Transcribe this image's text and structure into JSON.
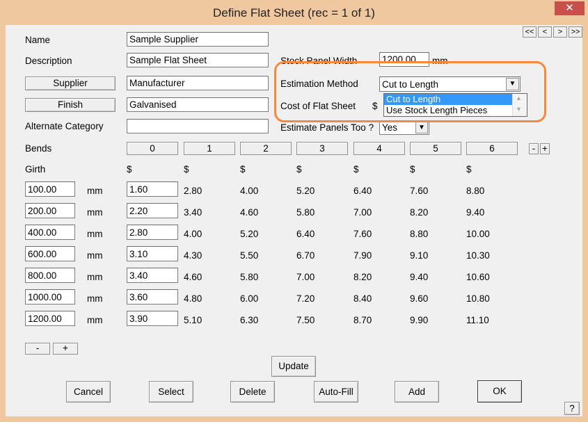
{
  "window": {
    "title": "Define Flat Sheet (rec = 1 of 1)",
    "close_glyph": "✕"
  },
  "nav": {
    "first": "<<",
    "prev": "<",
    "next": ">",
    "last": ">>"
  },
  "fields": {
    "name_label": "Name",
    "name_value": "Sample Supplier",
    "description_label": "Description",
    "description_value": "Sample Flat Sheet",
    "supplier_button": "Supplier",
    "supplier_value": "Manufacturer",
    "finish_button": "Finish",
    "finish_value": "Galvanised",
    "alt_category_label": "Alternate Category",
    "alt_category_value": ""
  },
  "right": {
    "stock_panel_label": "Stock Panel Width",
    "stock_panel_value": "1200.00",
    "stock_panel_unit": "mm",
    "estimation_label": "Estimation Method",
    "estimation_value": "Cut to Length",
    "estimation_options": [
      "Cut to Length",
      "Use Stock Length Pieces"
    ],
    "cost_label": "Cost of Flat Sheet",
    "cost_prefix": "$",
    "estimate_panels_label": "Estimate Panels Too ?",
    "estimate_panels_value": "Yes"
  },
  "bends": {
    "label": "Bends",
    "values": [
      "0",
      "1",
      "2",
      "3",
      "4",
      "5",
      "6"
    ],
    "minus": "-",
    "plus": "+"
  },
  "girth": {
    "label": "Girth",
    "currency": "$",
    "unit": "mm",
    "rows": [
      {
        "girth": "100.00",
        "prices": [
          "1.60",
          "2.80",
          "4.00",
          "5.20",
          "6.40",
          "7.60",
          "8.80"
        ]
      },
      {
        "girth": "200.00",
        "prices": [
          "2.20",
          "3.40",
          "4.60",
          "5.80",
          "7.00",
          "8.20",
          "9.40"
        ]
      },
      {
        "girth": "400.00",
        "prices": [
          "2.80",
          "4.00",
          "5.20",
          "6.40",
          "7.60",
          "8.80",
          "10.00"
        ]
      },
      {
        "girth": "600.00",
        "prices": [
          "3.10",
          "4.30",
          "5.50",
          "6.70",
          "7.90",
          "9.10",
          "10.30"
        ]
      },
      {
        "girth": "800.00",
        "prices": [
          "3.40",
          "4.60",
          "5.80",
          "7.00",
          "8.20",
          "9.40",
          "10.60"
        ]
      },
      {
        "girth": "1000.00",
        "prices": [
          "3.60",
          "4.80",
          "6.00",
          "7.20",
          "8.40",
          "9.60",
          "10.80"
        ]
      },
      {
        "girth": "1200.00",
        "prices": [
          "3.90",
          "5.10",
          "6.30",
          "7.50",
          "8.70",
          "9.90",
          "11.10"
        ]
      }
    ],
    "minus": "-",
    "plus": "+"
  },
  "actions": {
    "update": "Update",
    "cancel": "Cancel",
    "select": "Select",
    "delete": "Delete",
    "autofill": "Auto-Fill",
    "add": "Add",
    "ok": "OK",
    "help": "?"
  },
  "colors": {
    "highlight": "#f58a3c",
    "selected": "#3399ff",
    "close": "#c7504a"
  }
}
